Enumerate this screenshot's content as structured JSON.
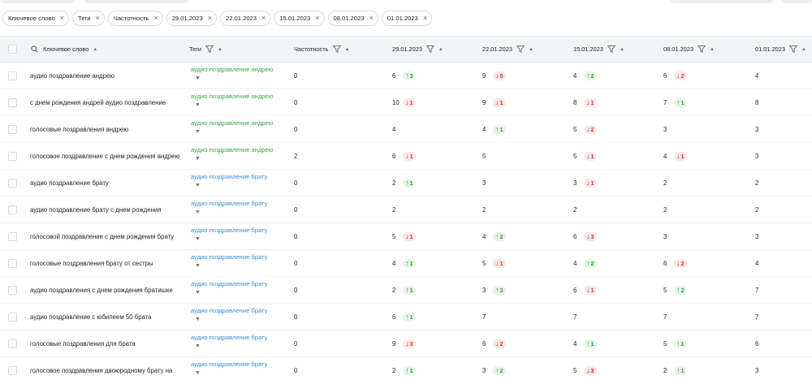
{
  "filter_chips": [
    "Ключевое слово",
    "Теги",
    "Частотность",
    "29.01.2023",
    "22.01.2023",
    "15.01.2023",
    "08.01.2023",
    "01.01.2023"
  ],
  "columns": {
    "keyword": "Ключевое слово",
    "tags": "Теги",
    "frequency": "Частотность",
    "dates": [
      "29.01.2023",
      "22.01.2023",
      "15.01.2023",
      "08.01.2023",
      "01.01.2023"
    ]
  },
  "colors": {
    "tag_green": "#3fa63f",
    "tag_blue": "#3b8fd6",
    "up": "#3a9c3a",
    "down": "#d33a3a"
  },
  "rows": [
    {
      "keyword": "аудио поздравление андрею",
      "tag": "аудио поздравление андрею",
      "tag_color": "green",
      "freq": "0",
      "cells": [
        {
          "v": "6",
          "d": "3",
          "dir": "up"
        },
        {
          "v": "9",
          "d": "5",
          "dir": "down"
        },
        {
          "v": "4",
          "d": "2",
          "dir": "up"
        },
        {
          "v": "6",
          "d": "2",
          "dir": "down"
        },
        {
          "v": "4"
        }
      ]
    },
    {
      "keyword": "с днем рождения андрей аудио поздравление",
      "tag": "аудио поздравление андрею",
      "tag_color": "green",
      "freq": "0",
      "cells": [
        {
          "v": "10",
          "d": "1",
          "dir": "down"
        },
        {
          "v": "9",
          "d": "1",
          "dir": "down"
        },
        {
          "v": "8",
          "d": "1",
          "dir": "down"
        },
        {
          "v": "7",
          "d": "1",
          "dir": "up"
        },
        {
          "v": "8"
        }
      ]
    },
    {
      "keyword": "голосовые поздравления андрею",
      "tag": "аудио поздравление андрею",
      "tag_color": "green",
      "freq": "0",
      "cells": [
        {
          "v": "4"
        },
        {
          "v": "4",
          "d": "1",
          "dir": "up"
        },
        {
          "v": "5",
          "d": "2",
          "dir": "down"
        },
        {
          "v": "3"
        },
        {
          "v": "3"
        }
      ]
    },
    {
      "keyword": "голосовое поздравление с днем рождения андрею",
      "tag": "аудио поздравление андрею",
      "tag_color": "green",
      "freq": "2",
      "cells": [
        {
          "v": "6",
          "d": "1",
          "dir": "down"
        },
        {
          "v": "5"
        },
        {
          "v": "5",
          "d": "1",
          "dir": "down"
        },
        {
          "v": "4",
          "d": "1",
          "dir": "down"
        },
        {
          "v": "3"
        }
      ]
    },
    {
      "keyword": "аудио поздравление брату",
      "tag": "аудио поздравление брату",
      "tag_color": "blue",
      "freq": "0",
      "cells": [
        {
          "v": "2",
          "d": "1",
          "dir": "up"
        },
        {
          "v": "3"
        },
        {
          "v": "3",
          "d": "1",
          "dir": "down"
        },
        {
          "v": "2"
        },
        {
          "v": "2"
        }
      ]
    },
    {
      "keyword": "аудио поздравление брату с днем рождения",
      "tag": "аудио поздравление брату",
      "tag_color": "blue",
      "freq": "0",
      "cells": [
        {
          "v": "2"
        },
        {
          "v": "2"
        },
        {
          "v": "2"
        },
        {
          "v": "2"
        },
        {
          "v": "2"
        }
      ]
    },
    {
      "keyword": "голосовой поздравление с днем рождения брату",
      "tag": "аудио поздравление брату",
      "tag_color": "blue",
      "freq": "0",
      "cells": [
        {
          "v": "5",
          "d": "1",
          "dir": "down"
        },
        {
          "v": "4",
          "d": "2",
          "dir": "up"
        },
        {
          "v": "6",
          "d": "3",
          "dir": "down"
        },
        {
          "v": "3"
        },
        {
          "v": "3"
        }
      ]
    },
    {
      "keyword": "голосовые поздравления брату от сестры",
      "tag": "аудио поздравление брату",
      "tag_color": "blue",
      "freq": "0",
      "cells": [
        {
          "v": "4",
          "d": "1",
          "dir": "up"
        },
        {
          "v": "5",
          "d": "1",
          "dir": "down"
        },
        {
          "v": "4",
          "d": "2",
          "dir": "up"
        },
        {
          "v": "6",
          "d": "2",
          "dir": "down"
        },
        {
          "v": "4"
        }
      ]
    },
    {
      "keyword": "аудио поздравления с днем рождения братишке",
      "tag": "аудио поздравление брату",
      "tag_color": "blue",
      "freq": "0",
      "cells": [
        {
          "v": "2",
          "d": "1",
          "dir": "up"
        },
        {
          "v": "3",
          "d": "3",
          "dir": "up"
        },
        {
          "v": "6",
          "d": "1",
          "dir": "down"
        },
        {
          "v": "5",
          "d": "2",
          "dir": "up"
        },
        {
          "v": "7"
        }
      ]
    },
    {
      "keyword": "аудио поздравление с юбилеем 50 брата",
      "tag": "аудио поздравление брату",
      "tag_color": "blue",
      "freq": "0",
      "cells": [
        {
          "v": "6",
          "d": "1",
          "dir": "up"
        },
        {
          "v": "7"
        },
        {
          "v": "7"
        },
        {
          "v": "7"
        },
        {
          "v": "7"
        }
      ]
    },
    {
      "keyword": "голосовые поздравления для брата",
      "tag": "аудио поздравление брату",
      "tag_color": "blue",
      "freq": "0",
      "cells": [
        {
          "v": "9",
          "d": "3",
          "dir": "down"
        },
        {
          "v": "6",
          "d": "2",
          "dir": "down"
        },
        {
          "v": "4",
          "d": "1",
          "dir": "up"
        },
        {
          "v": "5",
          "d": "1",
          "dir": "up"
        },
        {
          "v": "6"
        }
      ]
    },
    {
      "keyword": "голосовое поздравления двоюродному брату на",
      "tag": "аудио поздравление брату",
      "tag_color": "blue",
      "freq": "0",
      "cells": [
        {
          "v": "2",
          "d": "1",
          "dir": "up"
        },
        {
          "v": "3",
          "d": "2",
          "dir": "up"
        },
        {
          "v": "5",
          "d": "3",
          "dir": "down"
        },
        {
          "v": "2",
          "d": "1",
          "dir": "up"
        },
        {
          "v": "3"
        }
      ]
    }
  ]
}
